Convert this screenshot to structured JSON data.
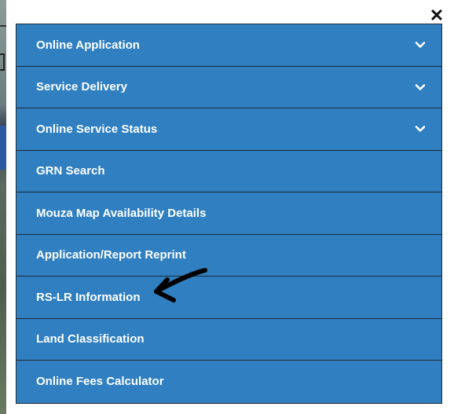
{
  "modal": {
    "close_symbol": "✕",
    "close_icon": "close-icon"
  },
  "menu": {
    "items": [
      {
        "label": "Online Application",
        "has_submenu": true
      },
      {
        "label": "Service Delivery",
        "has_submenu": true
      },
      {
        "label": "Online Service Status",
        "has_submenu": true
      },
      {
        "label": "GRN Search",
        "has_submenu": false
      },
      {
        "label": "Mouza Map Availability Details",
        "has_submenu": false
      },
      {
        "label": "Application/Report Reprint",
        "has_submenu": false
      },
      {
        "label": "RS-LR Information",
        "has_submenu": false
      },
      {
        "label": "Land Classification",
        "has_submenu": false
      },
      {
        "label": "Online Fees Calculator",
        "has_submenu": false
      }
    ]
  },
  "colors": {
    "menu_bg": "#2f7fc1",
    "menu_text": "#ffffff",
    "divider": "#1f2a36",
    "annotation": "#000000"
  }
}
